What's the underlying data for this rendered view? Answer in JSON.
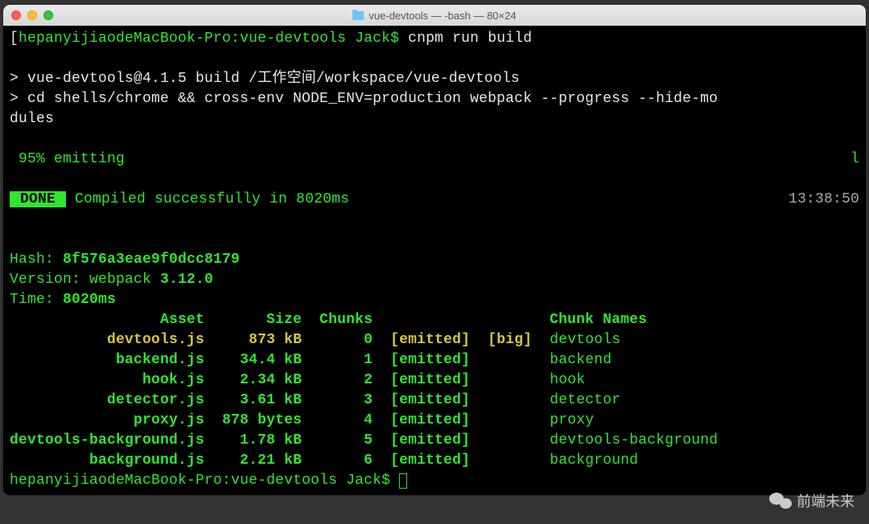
{
  "window": {
    "title": "vue-devtools — -bash — 80×24"
  },
  "prompt": {
    "host": "hepanyijiaodeMacBook-Pro",
    "dir": "vue-devtools",
    "user": "Jack",
    "sep": "$",
    "command": "cnpm run build"
  },
  "script": {
    "line1": "> vue-devtools@4.1.5 build /工作空间/workspace/vue-devtools",
    "line2a": "> cd shells/chrome && cross-env NODE_ENV=production webpack --progress --hide-mo",
    "line2b": "dules"
  },
  "progress": {
    "text": " 95% emitting",
    "tail": "l"
  },
  "done": {
    "badge": " DONE ",
    "msg": " Compiled successfully in 8020ms",
    "time": "13:38:50"
  },
  "summary": {
    "hash_label": "Hash: ",
    "hash": "8f576a3eae9f0dcc8179",
    "version_label": "Version: webpack ",
    "version": "3.12.0",
    "time_label": "Time: ",
    "time": "8020ms"
  },
  "table": {
    "headers": {
      "asset": "Asset",
      "size": "Size",
      "chunks": "Chunks",
      "chunk_names": "Chunk Names"
    },
    "rows": [
      {
        "asset": "devtools.js",
        "size": "873 kB",
        "chunk": "0",
        "status": "[emitted]",
        "flag": "[big]",
        "name": "devtools",
        "big": true
      },
      {
        "asset": "backend.js",
        "size": "34.4 kB",
        "chunk": "1",
        "status": "[emitted]",
        "flag": "",
        "name": "backend",
        "big": false
      },
      {
        "asset": "hook.js",
        "size": "2.34 kB",
        "chunk": "2",
        "status": "[emitted]",
        "flag": "",
        "name": "hook",
        "big": false
      },
      {
        "asset": "detector.js",
        "size": "3.61 kB",
        "chunk": "3",
        "status": "[emitted]",
        "flag": "",
        "name": "detector",
        "big": false
      },
      {
        "asset": "proxy.js",
        "size": "878 bytes",
        "chunk": "4",
        "status": "[emitted]",
        "flag": "",
        "name": "proxy",
        "big": false
      },
      {
        "asset": "devtools-background.js",
        "size": "1.78 kB",
        "chunk": "5",
        "status": "[emitted]",
        "flag": "",
        "name": "devtools-background",
        "big": false
      },
      {
        "asset": "background.js",
        "size": "2.21 kB",
        "chunk": "6",
        "status": "[emitted]",
        "flag": "",
        "name": "background",
        "big": false
      }
    ]
  },
  "footer": {
    "text": "前端未来"
  }
}
